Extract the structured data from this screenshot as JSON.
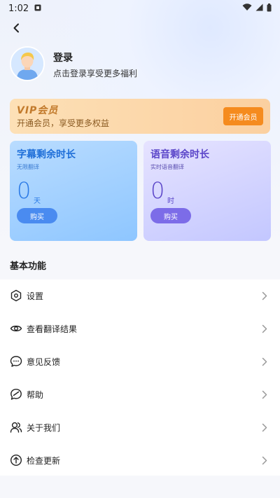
{
  "status_bar": {
    "time": "1:02"
  },
  "profile": {
    "title": "登录",
    "subtitle": "点击登录享受更多福利"
  },
  "vip": {
    "title": "VIP会员",
    "subtitle": "开通会员，享受更多权益",
    "button": "开通会员"
  },
  "cards": {
    "subtitle": {
      "title": "字幕剩余时长",
      "sub": "无限翻译",
      "number": "0",
      "unit": "天",
      "button": "购买"
    },
    "voice": {
      "title": "语音剩余时长",
      "sub": "实时语音翻译",
      "number": "0",
      "unit": "时",
      "button": "购买"
    }
  },
  "section_title": "基本功能",
  "menu": {
    "items": [
      {
        "label": "设置",
        "icon": "settings-icon"
      },
      {
        "label": "查看翻译结果",
        "icon": "eye-icon"
      },
      {
        "label": "意见反馈",
        "icon": "feedback-icon"
      },
      {
        "label": "帮助",
        "icon": "help-icon"
      },
      {
        "label": "关于我们",
        "icon": "about-icon"
      },
      {
        "label": "检查更新",
        "icon": "update-icon"
      }
    ]
  },
  "colors": {
    "accent_orange": "#f58b1e",
    "subtitle_blue": "#2b7ae6",
    "voice_purple": "#5b46c9"
  }
}
